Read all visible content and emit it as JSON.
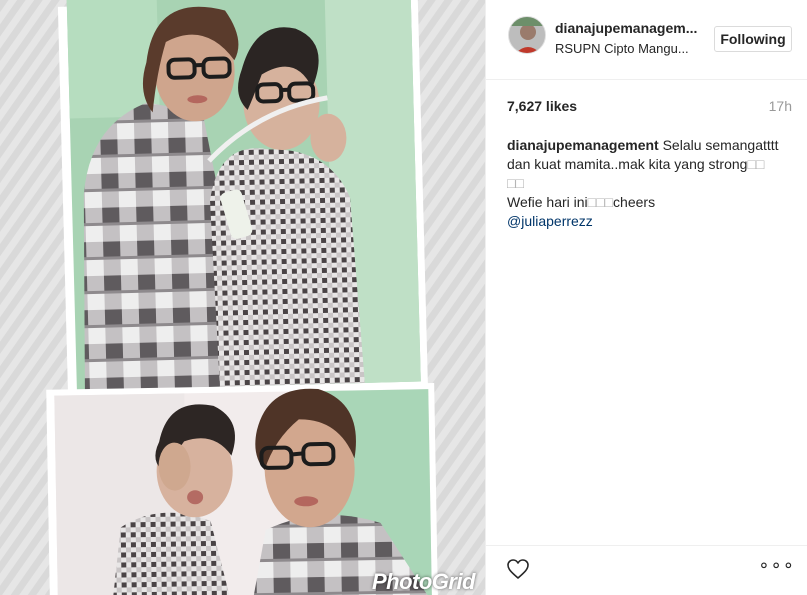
{
  "post": {
    "photo": {
      "watermark": "PhotoGrid",
      "alt": "two women wearing glasses taking a selfie"
    },
    "header": {
      "username": "dianajupemanagem...",
      "location": "RSUPN Cipto Mangu...",
      "follow_label": "Following"
    },
    "stats": {
      "likes": "7,627 likes",
      "time": "17h"
    },
    "caption": {
      "username": "dianajupemanagement",
      "line1": "Selalu semangatttt",
      "line2": "dan kuat mamita..mak kita yang strong",
      "line2_glyphs": "□□",
      "line3_glyphs": "□□",
      "line4_start": "Wefie hari ini",
      "line4_glyphs": "□□□",
      "line4_end": "cheers",
      "mention": "@juliaperrezz"
    },
    "footer": {
      "like_icon": "heart-icon",
      "more_label": "∘∘∘"
    }
  },
  "colors": {
    "text": "#262626",
    "muted": "#999999",
    "link": "#003569",
    "border": "#dbdbdb"
  }
}
